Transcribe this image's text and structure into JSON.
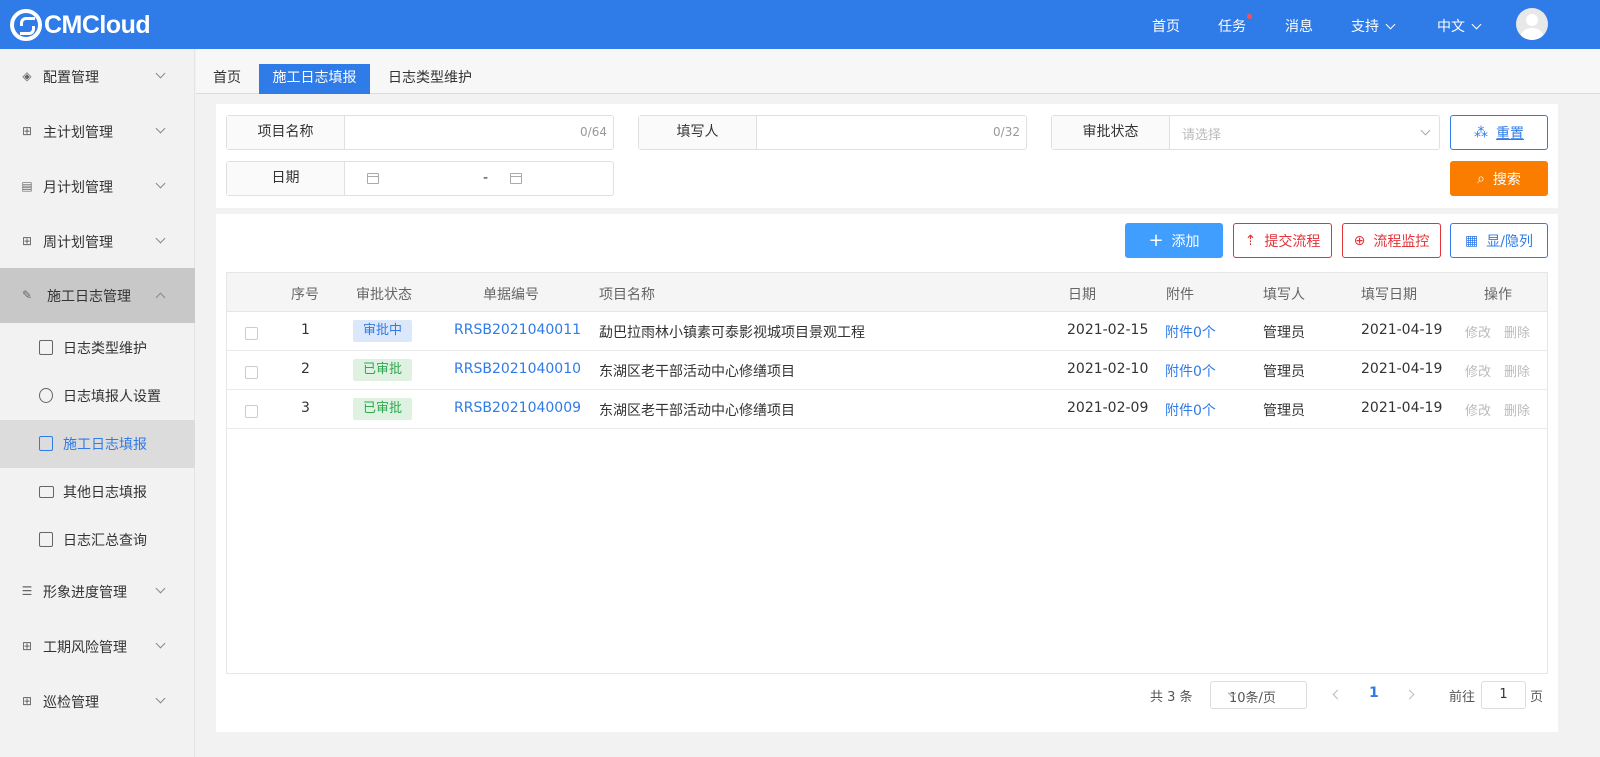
{
  "brand": {
    "name": "CMCloud"
  },
  "topnav": {
    "home": "首页",
    "tasks": "任务",
    "messages": "消息",
    "support": "支持",
    "language": "中文"
  },
  "sidebar": {
    "items": [
      {
        "label": "配置管理"
      },
      {
        "label": "主计划管理"
      },
      {
        "label": "月计划管理"
      },
      {
        "label": "周计划管理"
      },
      {
        "label": "施工日志管理"
      },
      {
        "label": "形象进度管理"
      },
      {
        "label": "工期风险管理"
      },
      {
        "label": "巡检管理"
      }
    ],
    "subitems": [
      {
        "label": "日志类型维护"
      },
      {
        "label": "日志填报人设置"
      },
      {
        "label": "施工日志填报"
      },
      {
        "label": "其他日志填报"
      },
      {
        "label": "日志汇总查询"
      }
    ]
  },
  "tabs": [
    {
      "label": "首页"
    },
    {
      "label": "施工日志填报"
    },
    {
      "label": "日志类型维护"
    }
  ],
  "filters": {
    "project_name": {
      "label": "项目名称",
      "count": "0/64"
    },
    "filler": {
      "label": "填写人",
      "count": "0/32"
    },
    "status": {
      "label": "审批状态",
      "placeholder": "请选择"
    },
    "date": {
      "label": "日期",
      "separator": "-"
    },
    "reset": "重置",
    "search": "搜索"
  },
  "actions": {
    "add": "添加",
    "submit_flow": "提交流程",
    "monitor_flow": "流程监控",
    "toggle_columns": "显/隐列"
  },
  "table": {
    "headers": [
      "序号",
      "审批状态",
      "单据编号",
      "项目名称",
      "日期",
      "附件",
      "填写人",
      "填写日期",
      "操作"
    ],
    "rows": [
      {
        "no": "1",
        "status": "审批中",
        "code": "RRSB2021040011",
        "project": "勐巴拉雨林小镇素可泰影视城项目景观工程",
        "date": "2021-02-15",
        "attachment": "附件0个",
        "filler": "管理员",
        "fill_date": "2021-04-19",
        "edit": "修改",
        "delete": "删除"
      },
      {
        "no": "2",
        "status": "已审批",
        "code": "RRSB2021040010",
        "project": "东湖区老干部活动中心修缮项目",
        "date": "2021-02-10",
        "attachment": "附件0个",
        "filler": "管理员",
        "fill_date": "2021-04-19",
        "edit": "修改",
        "delete": "删除"
      },
      {
        "no": "3",
        "status": "已审批",
        "code": "RRSB2021040009",
        "project": "东湖区老干部活动中心修缮项目",
        "date": "2021-02-09",
        "attachment": "附件0个",
        "filler": "管理员",
        "fill_date": "2021-04-19",
        "edit": "修改",
        "delete": "删除"
      }
    ]
  },
  "pagination": {
    "total": "共 3 条",
    "page_size": "10条/页",
    "current": "1",
    "goto_label": "前往",
    "goto_value": "1",
    "page_suffix": "页"
  },
  "colors": {
    "primary": "#2f7be8",
    "orange": "#fa7d00",
    "danger": "#e0333a",
    "success": "#2fa84f"
  }
}
